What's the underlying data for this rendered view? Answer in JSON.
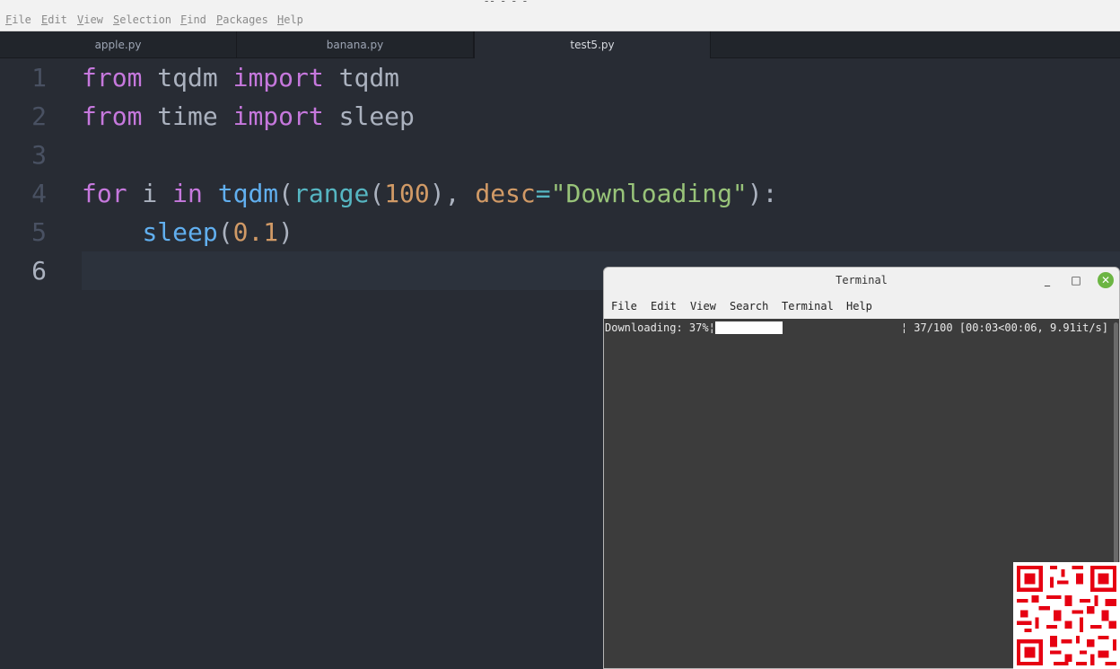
{
  "window_title": "-- - - -",
  "menu": [
    "File",
    "Edit",
    "View",
    "Selection",
    "Find",
    "Packages",
    "Help"
  ],
  "tabs": [
    {
      "label": "apple.py",
      "active": false
    },
    {
      "label": "banana.py",
      "active": false
    },
    {
      "label": "test5.py",
      "active": true
    }
  ],
  "editor": {
    "current_line": 6,
    "lines": [
      {
        "number": "1"
      },
      {
        "number": "2"
      },
      {
        "number": "3"
      },
      {
        "number": "4"
      },
      {
        "number": "5"
      },
      {
        "number": "6"
      }
    ],
    "tokens": {
      "l1": [
        "from",
        " tqdm ",
        "import",
        " tqdm"
      ],
      "l2": [
        "from",
        " time ",
        "import",
        " sleep"
      ],
      "l4": [
        "for",
        " i ",
        "in",
        " ",
        "tqdm",
        "(",
        "range",
        "(",
        "100",
        "), ",
        "desc",
        "=",
        "\"Downloading\"",
        "):"
      ],
      "l5": [
        "    ",
        "sleep",
        "(",
        "0.1",
        ")"
      ]
    }
  },
  "terminal": {
    "title": "Terminal",
    "controls": {
      "minimize": "_",
      "maximize": "□",
      "close": "✕"
    },
    "menu": [
      "File",
      "Edit",
      "View",
      "Search",
      "Terminal",
      "Help"
    ],
    "progress": {
      "desc": "Downloading:  37%¦",
      "fraction": 0.37,
      "stats": "¦ 37/100 [00:03<00:06,  9.91it/s]"
    }
  },
  "colors": {
    "editor_bg": "#282c34",
    "keyword": "#c678dd",
    "function": "#61afef",
    "builtin": "#56b6c2",
    "number": "#d19a66",
    "string": "#98c379",
    "terminal_bg": "#3c3c3c",
    "close_button": "#6cb543"
  },
  "icons": {
    "qr": "qr-code-icon"
  }
}
